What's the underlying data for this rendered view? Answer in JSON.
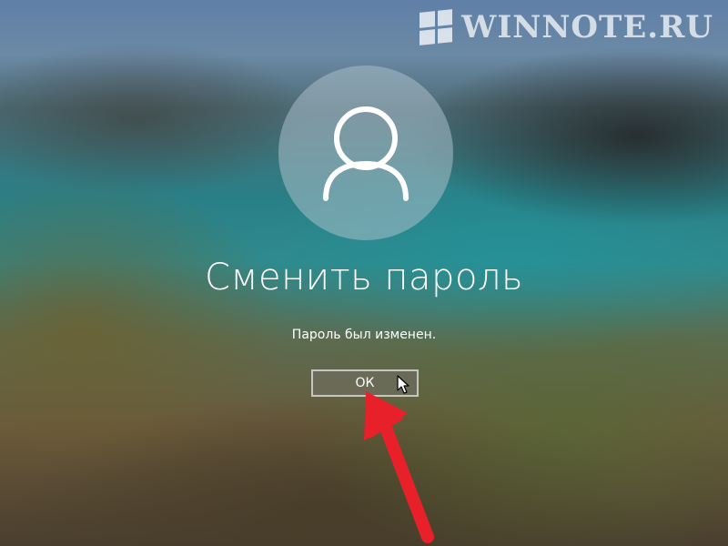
{
  "watermark": {
    "text": "WINNOTE.RU",
    "icon": "windows-logo-icon"
  },
  "user": {
    "avatar_icon": "user-icon"
  },
  "dialog": {
    "title": "Сменить пароль",
    "message": "Пароль был изменен.",
    "ok_label": "ОК"
  },
  "overlay": {
    "pointer_icon": "mouse-cursor-icon",
    "annotation_icon": "red-arrow-icon",
    "annotation_color": "#e8202a"
  }
}
